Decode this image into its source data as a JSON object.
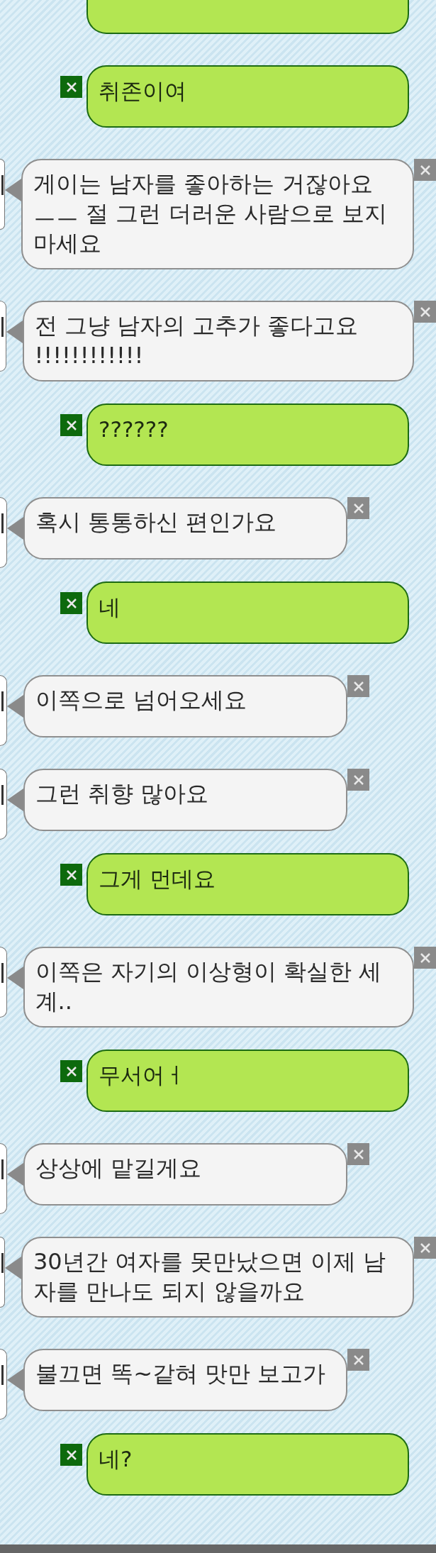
{
  "messages": [
    {
      "kind": "sent",
      "cut": true
    },
    {
      "kind": "sent",
      "text": "취존이여"
    },
    {
      "kind": "received",
      "text": "게이는 남자를 좋아하는 거잖아요 ㅡㅡ 절 그런 더러운 사람으로 보지마세요"
    },
    {
      "kind": "received",
      "text": "전 그냥 남자의 고추가 좋다고요 !!!!!!!!!!!!"
    },
    {
      "kind": "sent",
      "text": "??????"
    },
    {
      "kind": "received",
      "text": "혹시 통통하신 편인가요"
    },
    {
      "kind": "sent",
      "text": "네"
    },
    {
      "kind": "received",
      "text": "이쪽으로 넘어오세요"
    },
    {
      "kind": "received",
      "text": "그런 취향 많아요"
    },
    {
      "kind": "sent",
      "text": "그게 먼데요"
    },
    {
      "kind": "received",
      "text": "이쪽은 자기의 이상형이 확실한 세계.."
    },
    {
      "kind": "sent",
      "text": "무서어ㅓ"
    },
    {
      "kind": "received",
      "text": "상상에 맡길게요"
    },
    {
      "kind": "received",
      "text": "30년간 여자를 못만났으면 이제 남자를 만나도 되지 않을까요"
    },
    {
      "kind": "received",
      "text": "불끄면 똑~같혀 맛만 보고가"
    },
    {
      "kind": "sent",
      "text": "네?"
    }
  ]
}
